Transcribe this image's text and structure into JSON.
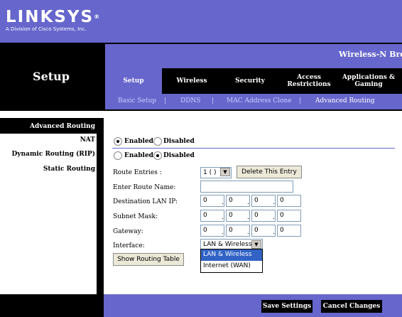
{
  "header": {
    "brand": "LINKSYS",
    "trademark": "®",
    "brand_sub": "A Division of Cisco Systems, Inc.",
    "product": "Wireless-N Broa"
  },
  "section_title": "Setup",
  "tabs": [
    {
      "label": "Setup",
      "active": true
    },
    {
      "label": "Wireless"
    },
    {
      "label": "Security"
    },
    {
      "label": "Access Restrictions"
    },
    {
      "label": "Applications & Gaming"
    }
  ],
  "subtabs": [
    "Basic Setup",
    "DDNS",
    "MAC Address Clone",
    "Advanced Routing"
  ],
  "sidebar": {
    "heading": "Advanced Routing",
    "items": [
      "NAT",
      "Dynamic Routing (RIP)",
      "Static Routing"
    ]
  },
  "nat": {
    "enabled_label": "Enabled",
    "disabled_label": "Disabled",
    "value": "Enabled"
  },
  "rip": {
    "enabled_label": "Enabled",
    "disabled_label": "Disabled",
    "value": "Disabled"
  },
  "static_routing": {
    "route_entries_label": "Route Entries :",
    "route_entries_value": "1 ( )",
    "delete_button": "Delete This Entry",
    "route_name_label": "Enter Route Name:",
    "route_name_value": "",
    "dest_ip_label": "Destination LAN IP:",
    "dest_ip": [
      "0",
      "0",
      "0",
      "0"
    ],
    "mask_label": "Subnet Mask:",
    "mask": [
      "0",
      "0",
      "0",
      "0"
    ],
    "gateway_label": "Gateway:",
    "gateway": [
      "0",
      "0",
      "0",
      "0"
    ],
    "interface_label": "Interface:",
    "interface_value": "LAN & Wireless",
    "interface_options": [
      "LAN & Wireless",
      "Internet (WAN)"
    ],
    "show_table_button": "Show Routing Table"
  },
  "footer": {
    "save": "Save Settings",
    "cancel": "Cancel Changes"
  },
  "colors": {
    "accent": "#6666cc",
    "header_bg": "#000000",
    "selected": "#3163c5"
  }
}
